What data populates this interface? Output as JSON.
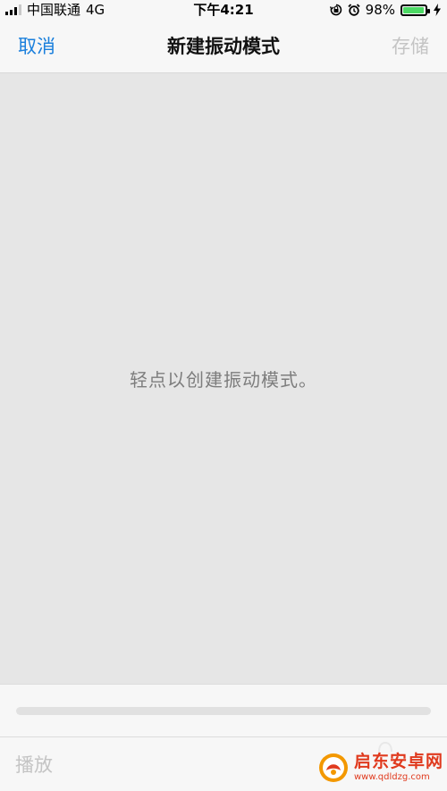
{
  "status_bar": {
    "carrier": "中国联通",
    "network": "4G",
    "time": "下午4:21",
    "battery_percent": "98%",
    "battery_level": 0.98,
    "icons": [
      "signal-icon",
      "orientation-lock-icon",
      "alarm-icon",
      "battery-icon",
      "charging-icon"
    ]
  },
  "nav_bar": {
    "cancel_label": "取消",
    "title": "新建振动模式",
    "save_label": "存储"
  },
  "canvas": {
    "hint": "轻点以创建振动模式。"
  },
  "timeline": {
    "progress": 0
  },
  "toolbar": {
    "play_label": "播放"
  },
  "watermark": {
    "title": "启东安卓网",
    "url": "www.qdldzg.com"
  },
  "colors": {
    "accent": "#1a7fdc",
    "disabled": "#c4c4c4",
    "canvas_bg": "#e6e6e6",
    "battery_green": "#4cd964",
    "watermark_red": "#e03a1e"
  }
}
